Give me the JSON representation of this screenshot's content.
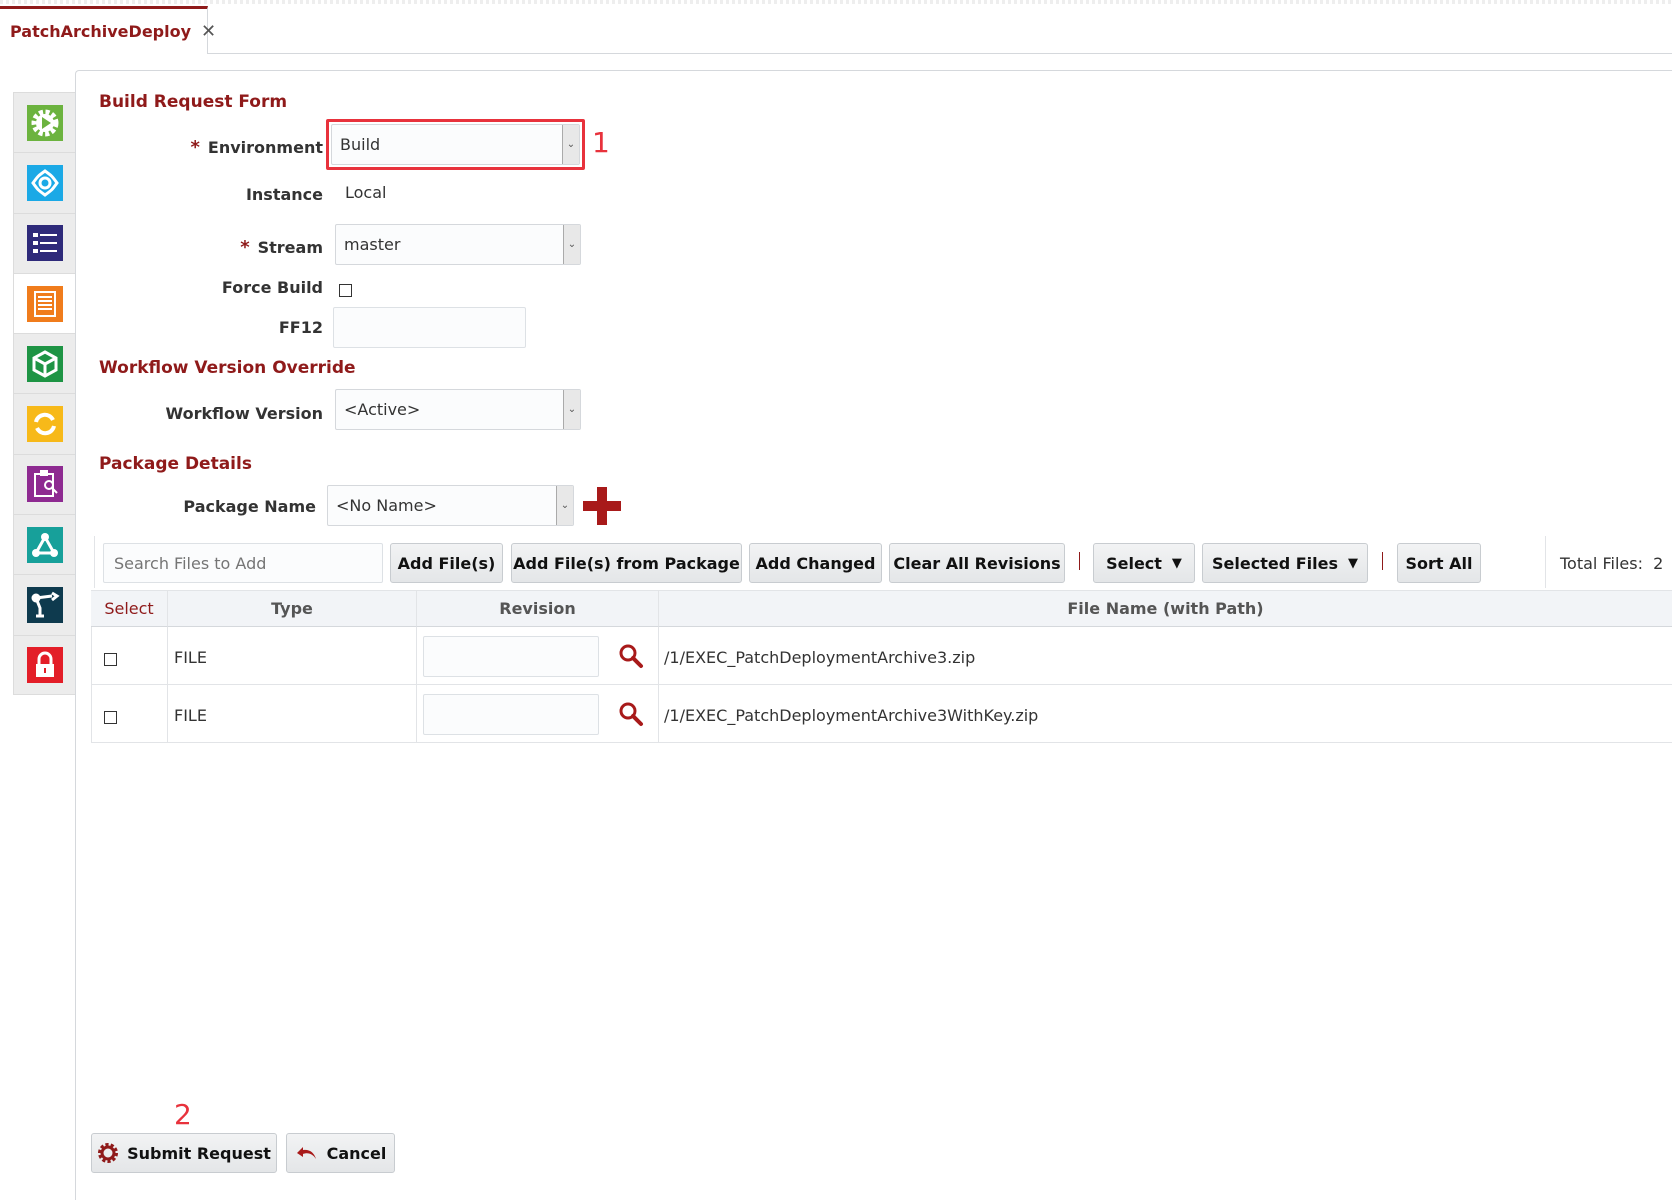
{
  "tab": {
    "title": "PatchArchiveDeploy",
    "close_icon": "close-icon"
  },
  "sidebar": {
    "items": [
      {
        "icon": "gear-play-icon",
        "color": "#6cb33f"
      },
      {
        "icon": "workflow-knot-icon",
        "color": "#1ba9e6"
      },
      {
        "icon": "list-checklist-icon",
        "color": "#2e2a7a"
      },
      {
        "icon": "document-form-icon",
        "color": "#f07c1c",
        "active": true
      },
      {
        "icon": "package-cube-icon",
        "color": "#1e9444"
      },
      {
        "icon": "refresh-cycle-icon",
        "color": "#f7b919"
      },
      {
        "icon": "clipboard-inspect-icon",
        "color": "#8e2a91"
      },
      {
        "icon": "network-nodes-icon",
        "color": "#17a09a"
      },
      {
        "icon": "robot-arm-icon",
        "color": "#0e3a4e"
      },
      {
        "icon": "lock-icon",
        "color": "#e31e28"
      }
    ]
  },
  "form": {
    "title": "Build Request Form",
    "environment": {
      "label": "Environment",
      "value": "Build"
    },
    "instance": {
      "label": "Instance",
      "value": "Local"
    },
    "stream": {
      "label": "Stream",
      "value": "master"
    },
    "force_build": {
      "label": "Force Build",
      "checked": false
    },
    "ff12": {
      "label": "FF12",
      "value": ""
    },
    "workflow_section": "Workflow Version Override",
    "workflow_version": {
      "label": "Workflow Version",
      "value": "<Active>"
    },
    "package_section": "Package Details",
    "package_name": {
      "label": "Package Name",
      "value": "<No Name>"
    }
  },
  "toolbar": {
    "search_placeholder": "Search Files to Add",
    "add_files": "Add File(s)",
    "add_from_package": "Add File(s) from Package",
    "add_changed": "Add Changed",
    "clear_revisions": "Clear All Revisions",
    "select": "Select",
    "selected_files": "Selected Files",
    "sort_all": "Sort All",
    "total_files": "Total Files:  2"
  },
  "table": {
    "columns": [
      "Select",
      "Type",
      "Revision",
      "File Name (with Path)"
    ],
    "rows": [
      {
        "type": "FILE",
        "revision": "",
        "file": "/1/EXEC_PatchDeploymentArchive3.zip"
      },
      {
        "type": "FILE",
        "revision": "",
        "file": "/1/EXEC_PatchDeploymentArchive3WithKey.zip"
      }
    ]
  },
  "footer": {
    "submit": "Submit Request",
    "cancel": "Cancel"
  },
  "annotations": {
    "one": "1",
    "two": "2"
  },
  "colors": {
    "accent": "#8f1a1a",
    "annotation": "#e8323c"
  }
}
